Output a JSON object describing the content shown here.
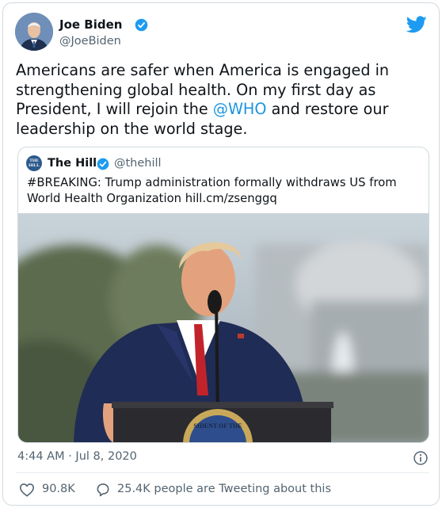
{
  "author": {
    "name": "Joe Biden",
    "handle": "@JoeBiden",
    "avatar_icon": "profile-photo",
    "verified": true
  },
  "brand": {
    "icon": "twitter-bird-icon",
    "color": "#1d9bf0"
  },
  "tweet": {
    "line1": "Americans are safer when America is engaged in",
    "line2": "strengthening global health. On my first day as",
    "line3_pre": "President, I will rejoin the ",
    "mention": "@WHO",
    "line3_post": " and restore our",
    "line4": "leadership on the world stage."
  },
  "quoted": {
    "avatar_text": "THE HILL",
    "name": "The Hill",
    "handle": "@thehill",
    "verified": true,
    "line1": "#BREAKING: Trump administration formally withdraws US from",
    "line2": "World Health Organization hill.cm/zsenggq",
    "podium_text": "SIDENT OF THE"
  },
  "meta": {
    "timestamp": "4:44 AM · Jul 8, 2020",
    "likes": "90.8K",
    "discussing": "25.4K people are Tweeting about this"
  },
  "colors": {
    "link": "#1b95e0",
    "secondary": "#536471",
    "verified": "#1d9bf0"
  }
}
